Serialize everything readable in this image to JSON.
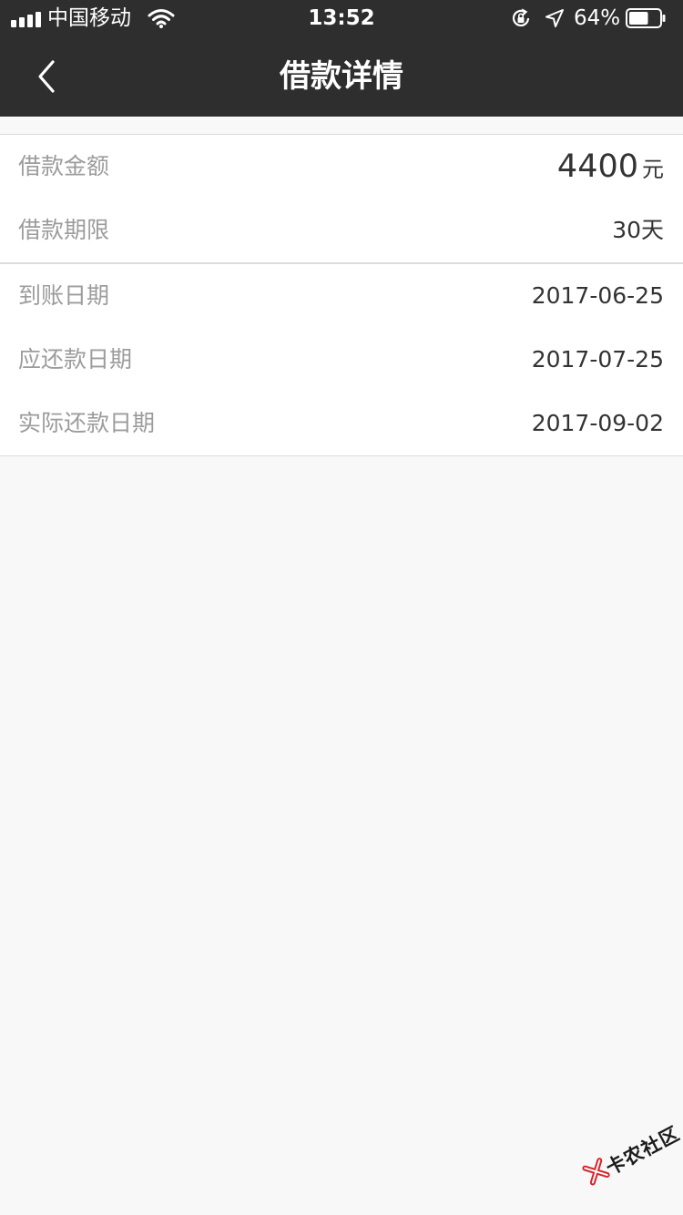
{
  "status_bar": {
    "carrier": "中国移动",
    "time": "13:52",
    "battery_percent": "64%",
    "signal_icon": "signal-bars-icon",
    "wifi_icon": "wifi-icon",
    "rotation_lock_icon": "rotation-lock-icon",
    "location_icon": "location-arrow-icon",
    "battery_icon": "battery-icon",
    "battery_level": 0.64
  },
  "nav": {
    "title": "借款详情",
    "back_icon": "chevron-left-icon"
  },
  "loan": {
    "amount_label": "借款金额",
    "amount_value": "4400",
    "amount_unit": "元",
    "term_label": "借款期限",
    "term_value": "30天"
  },
  "dates": {
    "arrival_label": "到账日期",
    "arrival_value": "2017-06-25",
    "due_label": "应还款日期",
    "due_value": "2017-07-25",
    "actual_label": "实际还款日期",
    "actual_value": "2017-09-02"
  },
  "watermark": {
    "text": "卡农社区",
    "logo_icon": "kanong-logo-icon"
  },
  "colors": {
    "topbar_bg": "#2e2e2e",
    "page_bg": "#f8f8f8",
    "card_bg": "#ffffff",
    "label_text": "#9c9c9c",
    "value_text": "#333333",
    "divider": "#dcdcdc",
    "watermark_red": "#d9252a"
  }
}
